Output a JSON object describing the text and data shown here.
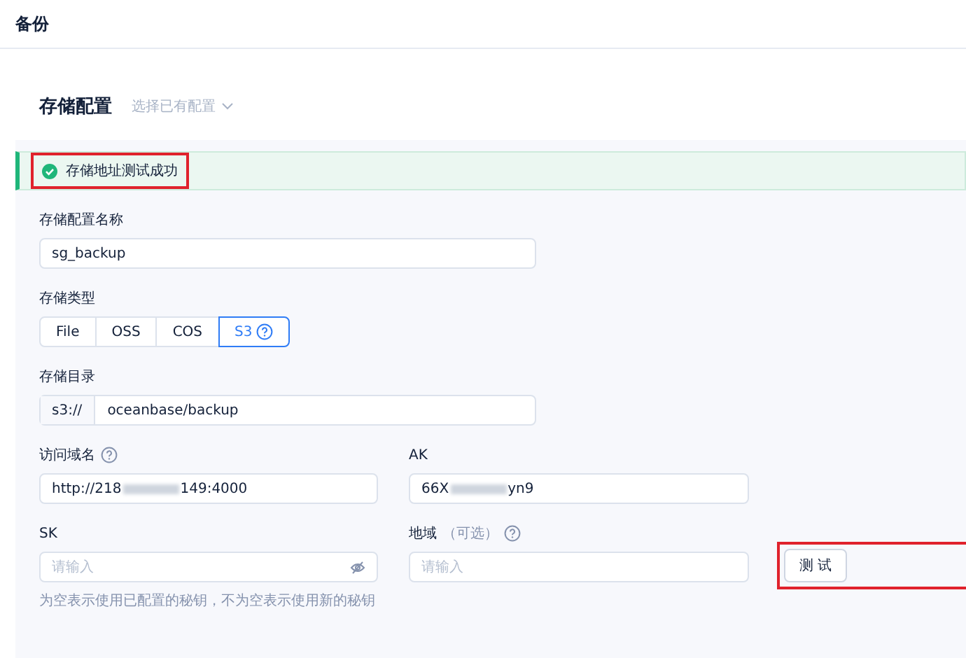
{
  "page": {
    "title": "备份"
  },
  "section": {
    "title": "存储配置",
    "select_existing": "选择已有配置"
  },
  "alert": {
    "text": "存储地址测试成功",
    "highlighted": true
  },
  "name_field": {
    "label": "存储配置名称",
    "value": "sg_backup"
  },
  "storage_type": {
    "label": "存储类型",
    "options": [
      {
        "label": "File",
        "selected": false
      },
      {
        "label": "OSS",
        "selected": false
      },
      {
        "label": "COS",
        "selected": false
      },
      {
        "label": "S3",
        "selected": true,
        "help": true
      }
    ]
  },
  "directory": {
    "label": "存储目录",
    "prefix": "s3://",
    "value": "oceanbase/backup"
  },
  "fields": [
    {
      "kind": "text",
      "label": "访问域名",
      "help": true,
      "value_start": "http://218",
      "value_end": "149:4000",
      "blurred": true
    },
    {
      "kind": "text",
      "label": "AK",
      "value_start": "66X",
      "value_end": "yn9",
      "blurred": true
    },
    {
      "kind": "password",
      "label": "SK",
      "placeholder": "请输入",
      "hint": "为空表示使用已配置的秘钥，不为空表示使用新的秘钥"
    },
    {
      "kind": "text",
      "label": "地域",
      "optional": "（可选）",
      "help": true,
      "placeholder": "请输入"
    }
  ],
  "test_button": {
    "label": "测 试",
    "highlighted": true
  }
}
